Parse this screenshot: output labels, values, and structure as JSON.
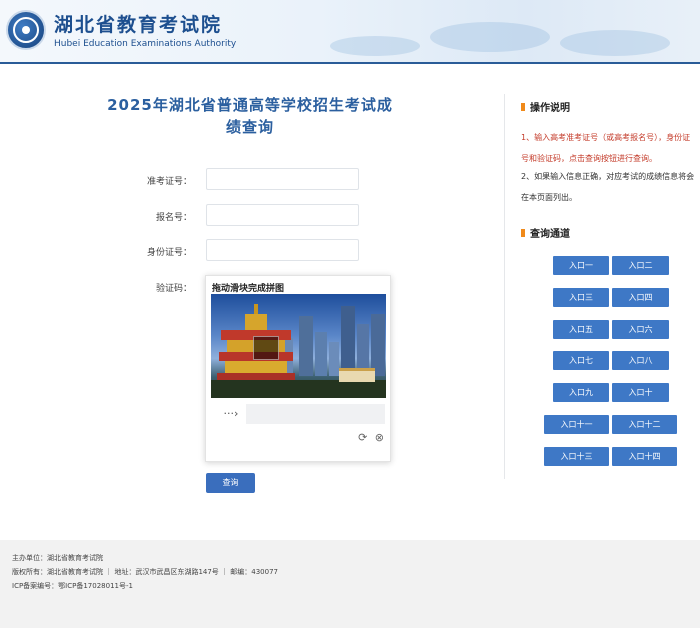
{
  "header": {
    "title": "湖北省教育考试院",
    "subtitle": "Hubei Education Examinations Authority"
  },
  "page_title_line1": "2025年湖北省普通高等学校招生考试成",
  "page_title_line2": "绩查询",
  "form": {
    "exam_no_label": "准考证号：",
    "reg_no_label": "报名号：",
    "id_no_label": "身份证号：",
    "captcha_label": "验证码："
  },
  "captcha": {
    "title": "拖动滑块完成拼图",
    "handle_glyph": "···›",
    "refresh_glyph": "⟳",
    "close_glyph": "⊗"
  },
  "query_button": "查询",
  "instructions": {
    "heading": "操作说明",
    "line1": "1、输入高考准考证号（或高考报名号），身份证",
    "line2": "号和验证码，点击查询按钮进行查询。",
    "line3": "2、如果输入信息正确，对应考试的成绩信息将会",
    "line4": "在本页面列出。"
  },
  "channels": {
    "heading": "查询通道",
    "entries": [
      "入口一",
      "入口二",
      "入口三",
      "入口四",
      "入口五",
      "入口六",
      "入口七",
      "入口八",
      "入口九",
      "入口十",
      "入口十一",
      "入口十二",
      "入口十三",
      "入口十四"
    ]
  },
  "footer": {
    "host": "主办单位：湖北省教育考试院",
    "copyright": "版权所有：湖北省教育考试院  ｜  地址：武汉市武昌区东湖路147号  ｜  邮编：430077",
    "icp": "ICP备案编号：鄂ICP备17028011号-1"
  },
  "colors": {
    "brand_blue": "#2b5f9f",
    "button_blue": "#3e78c6",
    "accent_orange": "#f08a1a",
    "instruction_red": "#c43c2b"
  }
}
